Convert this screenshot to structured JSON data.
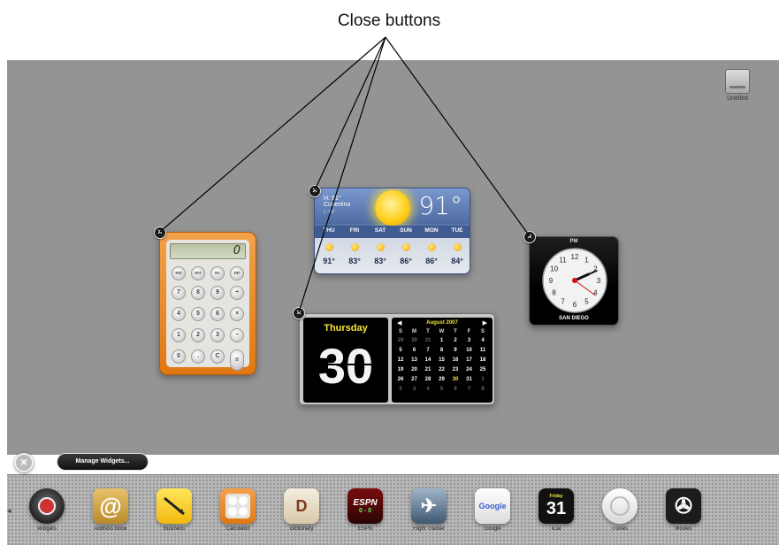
{
  "callout": {
    "title": "Close buttons"
  },
  "desktop": {
    "disk_label": "Untitled"
  },
  "close_button_symbol": "×",
  "calculator": {
    "display": "0",
    "memory_keys": [
      "mc",
      "m+",
      "m-",
      "mr"
    ],
    "keys": [
      "7",
      "8",
      "9",
      "4",
      "5",
      "6",
      "1",
      "2",
      "3",
      "0",
      ".",
      "C"
    ],
    "ops": [
      "÷",
      "×",
      "−",
      "+"
    ],
    "equals": "="
  },
  "weather": {
    "city": "Cupertino",
    "hi_label": "H: 91°",
    "lo_label": "L: 63°",
    "current_temp": "91°",
    "days": [
      {
        "name": "THU",
        "hi": "91°"
      },
      {
        "name": "FRI",
        "hi": "83°"
      },
      {
        "name": "SAT",
        "hi": "83°"
      },
      {
        "name": "SUN",
        "hi": "86°"
      },
      {
        "name": "MON",
        "hi": "86°"
      },
      {
        "name": "TUE",
        "hi": "84°"
      }
    ]
  },
  "clock": {
    "period": "PM",
    "city": "SAN DIEGO",
    "hour": 2,
    "minute": 11,
    "second": 21
  },
  "ical": {
    "day_name": "Thursday",
    "date": "30",
    "month_title": "August 2007",
    "prev_arrow": "◀",
    "next_arrow": "▶",
    "dow": [
      "S",
      "M",
      "T",
      "W",
      "T",
      "F",
      "S"
    ],
    "weeks": [
      [
        "29",
        "30",
        "31",
        "1",
        "2",
        "3",
        "4"
      ],
      [
        "5",
        "6",
        "7",
        "8",
        "9",
        "10",
        "11"
      ],
      [
        "12",
        "13",
        "14",
        "15",
        "16",
        "17",
        "18"
      ],
      [
        "19",
        "20",
        "21",
        "22",
        "23",
        "24",
        "25"
      ],
      [
        "26",
        "27",
        "28",
        "29",
        "30",
        "31",
        "1"
      ],
      [
        "2",
        "3",
        "4",
        "5",
        "6",
        "7",
        "8"
      ]
    ],
    "today": "30"
  },
  "manage_widgets": {
    "label": "Manage Widgets..."
  },
  "widget_bar": {
    "items": [
      {
        "name": "widgets-item",
        "icon": "widgets-icon",
        "label": "Widgets"
      },
      {
        "name": "address-book-item",
        "icon": "at-icon",
        "label": "Address Book"
      },
      {
        "name": "business-item",
        "icon": "business-icon",
        "label": "Business"
      },
      {
        "name": "calculator-item",
        "icon": "calculator-icon",
        "label": "Calculator"
      },
      {
        "name": "dictionary-item",
        "icon": "dictionary-icon",
        "label": "Dictionary"
      },
      {
        "name": "espn-item",
        "icon": "espn-icon",
        "label": "ESPN",
        "text": "ESPN",
        "score": "0 - 0"
      },
      {
        "name": "flight-tracker-item",
        "icon": "airplane-icon",
        "label": "Flight Tracker"
      },
      {
        "name": "google-item",
        "icon": "google-icon",
        "label": "Google",
        "text": "Google"
      },
      {
        "name": "ical-item",
        "icon": "calendar-icon",
        "label": "iCal",
        "weekday": "Friday",
        "date": "31"
      },
      {
        "name": "itunes-item",
        "icon": "itunes-icon",
        "label": "iTunes"
      },
      {
        "name": "movies-item",
        "icon": "film-reel-icon",
        "label": "Movies"
      }
    ]
  }
}
